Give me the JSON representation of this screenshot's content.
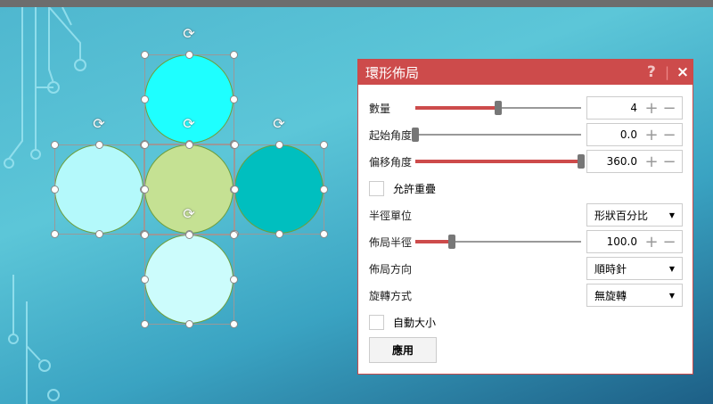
{
  "dialog": {
    "title": "環形佈局",
    "help": "?",
    "close": "×",
    "count": {
      "label": "數量",
      "value": "4",
      "fraction": 0.5
    },
    "start_angle": {
      "label": "起始角度",
      "value": "0.0",
      "fraction": 0.0
    },
    "offset_angle": {
      "label": "偏移角度",
      "value": "360.0",
      "fraction": 1.0
    },
    "allow_overlap": {
      "label": "允許重疊",
      "checked": false
    },
    "radius_unit": {
      "label": "半徑單位",
      "value": "形狀百分比"
    },
    "layout_radius": {
      "label": "佈局半徑",
      "value": "100.0",
      "fraction": 0.22
    },
    "direction": {
      "label": "佈局方向",
      "value": "順時針"
    },
    "rotation": {
      "label": "旋轉方式",
      "value": "無旋轉"
    },
    "auto_size": {
      "label": "自動大小",
      "checked": false
    },
    "apply": "應用",
    "plus": "+",
    "minus": "−",
    "dropdown": "▼"
  },
  "shapes": [
    {
      "name": "top",
      "color": "#1effff"
    },
    {
      "name": "left",
      "color": "#b4f9fb"
    },
    {
      "name": "center",
      "color": "#c5e193"
    },
    {
      "name": "right",
      "color": "#00bfbf"
    },
    {
      "name": "bottom",
      "color": "#ccfcfc"
    }
  ]
}
